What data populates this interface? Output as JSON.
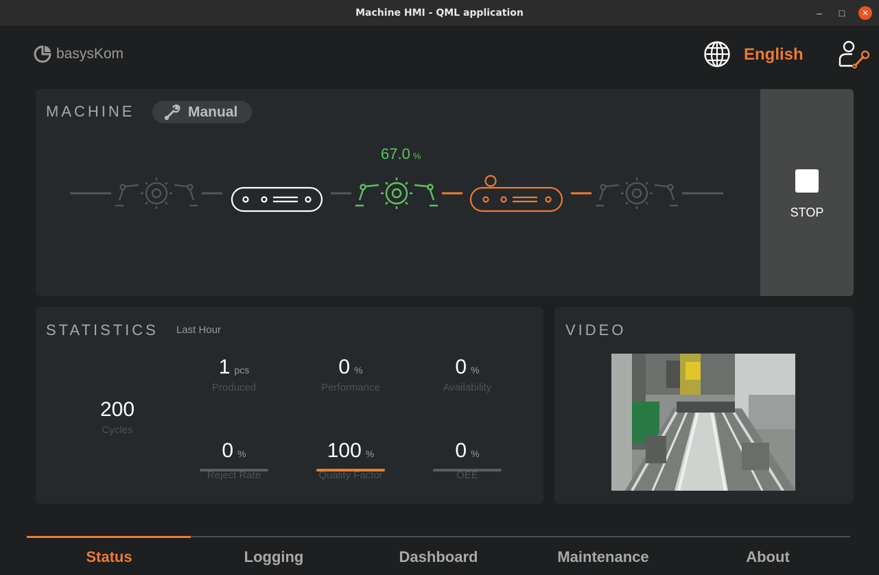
{
  "window": {
    "title": "Machine HMI - QML application",
    "controls": {
      "minimize": "–",
      "maximize": "□",
      "close": "✕"
    }
  },
  "header": {
    "logo_text": "basysKom",
    "language": "English",
    "globe_icon": "globe-icon",
    "user_icon": "user-maintenance-icon"
  },
  "colors": {
    "accent": "#ee7b30",
    "ok": "#5dc35f",
    "card": "#26292b",
    "background": "#1d1f20"
  },
  "machine": {
    "title": "MACHINE",
    "mode": "Manual",
    "mode_icon": "wrench-icon",
    "progress_value": "67.0",
    "progress_unit": "%",
    "stations": [
      {
        "name": "robot-station-1",
        "state": "idle"
      },
      {
        "name": "conveyor-1",
        "state": "ready"
      },
      {
        "name": "robot-station-2",
        "state": "running"
      },
      {
        "name": "conveyor-2",
        "state": "active"
      },
      {
        "name": "robot-station-3",
        "state": "idle"
      }
    ],
    "stop_label": "STOP"
  },
  "statistics": {
    "title": "STATISTICS",
    "period": "Last Hour",
    "cycles": {
      "value": "200",
      "label": "Cycles"
    },
    "metrics": [
      {
        "value": "1",
        "unit": "pcs",
        "label": "Produced"
      },
      {
        "value": "0",
        "unit": "%",
        "label": "Performance"
      },
      {
        "value": "0",
        "unit": "%",
        "label": "Availability"
      },
      {
        "value": "0",
        "unit": "%",
        "label": "Reject Rate",
        "bar_fraction": 0
      },
      {
        "value": "100",
        "unit": "%",
        "label": "Quality Factor",
        "bar_fraction": 1
      },
      {
        "value": "0",
        "unit": "%",
        "label": "OEE",
        "bar_fraction": 0
      }
    ]
  },
  "video": {
    "title": "VIDEO"
  },
  "nav": {
    "active": "Status",
    "tabs": [
      {
        "label": "Status"
      },
      {
        "label": "Logging"
      },
      {
        "label": "Dashboard"
      },
      {
        "label": "Maintenance"
      },
      {
        "label": "About"
      }
    ]
  }
}
